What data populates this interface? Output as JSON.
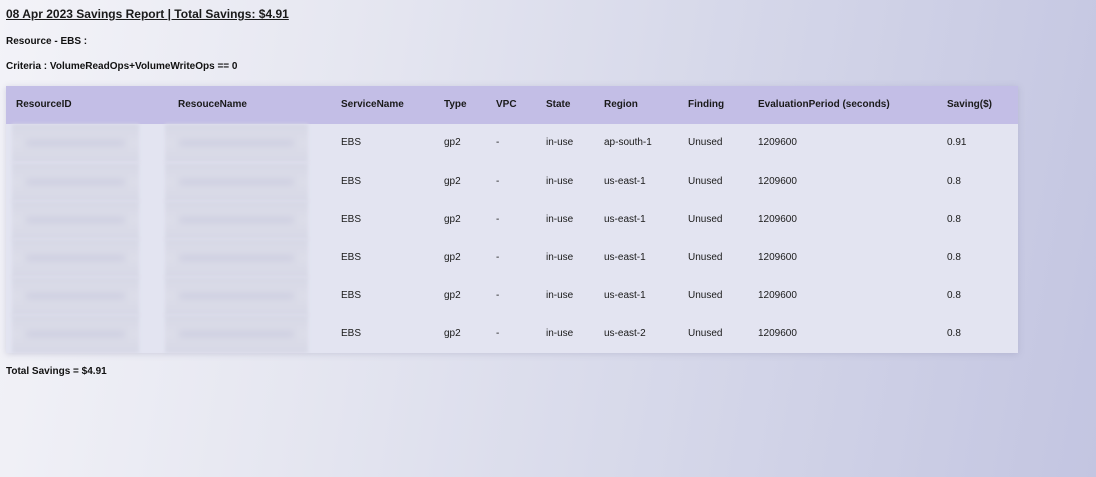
{
  "report": {
    "title": "08 Apr 2023 Savings Report | Total Savings: $4.91",
    "resource": "Resource - EBS :",
    "criteria": "Criteria : VolumeReadOps+VolumeWriteOps == 0",
    "total": "Total Savings = $4.91"
  },
  "table": {
    "headers": [
      "ResourceID",
      "ResouceName",
      "ServiceName",
      "Type",
      "VPC",
      "State",
      "Region",
      "Finding",
      "EvaluationPeriod (seconds)",
      "Saving($)"
    ],
    "rows": [
      {
        "service": "EBS",
        "type": "gp2",
        "vpc": "-",
        "state": "in-use",
        "region": "ap-south-1",
        "finding": "Unused",
        "period": "1209600",
        "saving": "0.91"
      },
      {
        "service": "EBS",
        "type": "gp2",
        "vpc": "-",
        "state": "in-use",
        "region": "us-east-1",
        "finding": "Unused",
        "period": "1209600",
        "saving": "0.8"
      },
      {
        "service": "EBS",
        "type": "gp2",
        "vpc": "-",
        "state": "in-use",
        "region": "us-east-1",
        "finding": "Unused",
        "period": "1209600",
        "saving": "0.8"
      },
      {
        "service": "EBS",
        "type": "gp2",
        "vpc": "-",
        "state": "in-use",
        "region": "us-east-1",
        "finding": "Unused",
        "period": "1209600",
        "saving": "0.8"
      },
      {
        "service": "EBS",
        "type": "gp2",
        "vpc": "-",
        "state": "in-use",
        "region": "us-east-1",
        "finding": "Unused",
        "period": "1209600",
        "saving": "0.8"
      },
      {
        "service": "EBS",
        "type": "gp2",
        "vpc": "-",
        "state": "in-use",
        "region": "us-east-2",
        "finding": "Unused",
        "period": "1209600",
        "saving": "0.8"
      }
    ]
  }
}
